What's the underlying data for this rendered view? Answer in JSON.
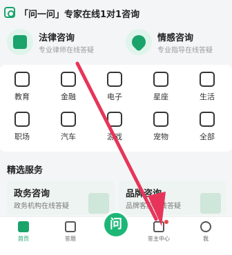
{
  "header": {
    "title": "「问一问」专家在线1对1咨询"
  },
  "consult_cards": [
    {
      "title": "法律咨询",
      "subtitle": "专业律师在线答疑",
      "icon": "document-icon"
    },
    {
      "title": "情感咨询",
      "subtitle": "专业指导在线答疑",
      "icon": "heart-icon"
    }
  ],
  "categories": [
    {
      "label": "教育",
      "icon": "graduation-cap-icon"
    },
    {
      "label": "金融",
      "icon": "money-bag-icon"
    },
    {
      "label": "电子",
      "icon": "phone-icon"
    },
    {
      "label": "星座",
      "icon": "star-icon"
    },
    {
      "label": "生活",
      "icon": "wallet-icon"
    },
    {
      "label": "职场",
      "icon": "tie-icon"
    },
    {
      "label": "汽车",
      "icon": "car-icon"
    },
    {
      "label": "游戏",
      "icon": "gamepad-icon"
    },
    {
      "label": "宠物",
      "icon": "pet-icon"
    },
    {
      "label": "全部",
      "icon": "grid-icon"
    }
  ],
  "services": {
    "title": "精选服务",
    "items": [
      {
        "title": "政务咨询",
        "subtitle": "政务机构在线答疑"
      },
      {
        "title": "品牌咨询",
        "subtitle": "品牌客服在线答疑"
      }
    ]
  },
  "tabbar": {
    "items": [
      {
        "label": "首页",
        "icon": "home-icon"
      },
      {
        "label": "答题",
        "icon": "note-icon"
      },
      {
        "label": "答主中心",
        "icon": "apps-icon"
      },
      {
        "label": "我",
        "icon": "user-icon"
      }
    ],
    "center_button": "问"
  },
  "colors": {
    "accent": "#1aa36b",
    "arrow": "#e8345a",
    "badge": "#e84a4a"
  }
}
